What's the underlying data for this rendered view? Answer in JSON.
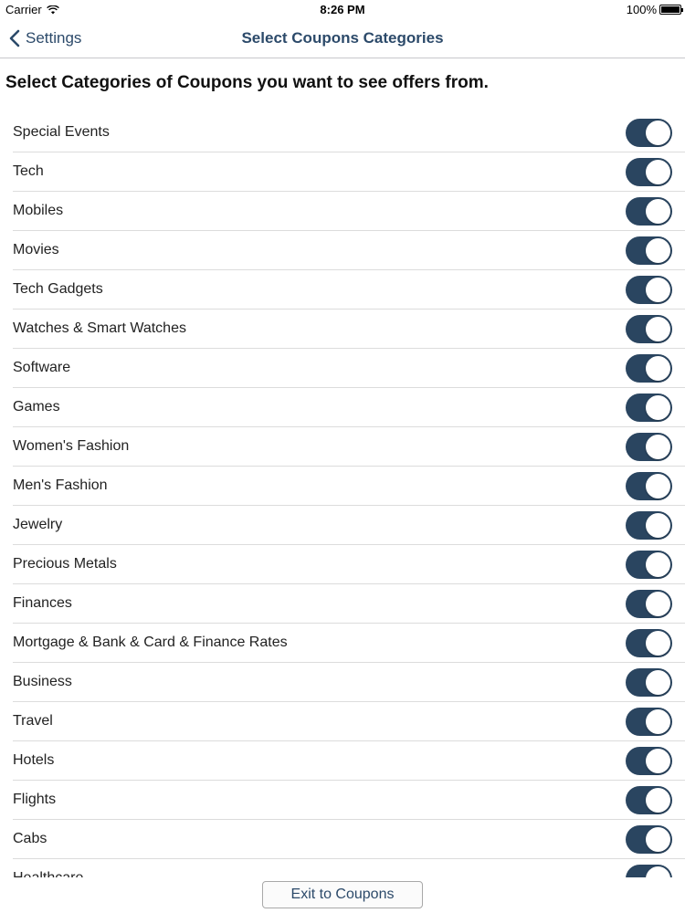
{
  "status_bar": {
    "carrier": "Carrier",
    "time": "8:26 PM",
    "battery": "100%"
  },
  "nav": {
    "back_label": "Settings",
    "title": "Select Coupons Categories"
  },
  "heading": "Select Categories of Coupons you want to see offers from.",
  "categories": [
    {
      "label": "Special Events",
      "on": true
    },
    {
      "label": "Tech",
      "on": true
    },
    {
      "label": "Mobiles",
      "on": true
    },
    {
      "label": "Movies",
      "on": true
    },
    {
      "label": "Tech Gadgets",
      "on": true
    },
    {
      "label": "Watches & Smart Watches",
      "on": true
    },
    {
      "label": "Software",
      "on": true
    },
    {
      "label": "Games",
      "on": true
    },
    {
      "label": "Women's Fashion",
      "on": true
    },
    {
      "label": "Men's Fashion",
      "on": true
    },
    {
      "label": "Jewelry",
      "on": true
    },
    {
      "label": "Precious Metals",
      "on": true
    },
    {
      "label": "Finances",
      "on": true
    },
    {
      "label": "Mortgage & Bank & Card & Finance Rates",
      "on": true
    },
    {
      "label": "Business",
      "on": true
    },
    {
      "label": "Travel",
      "on": true
    },
    {
      "label": "Hotels",
      "on": true
    },
    {
      "label": "Flights",
      "on": true
    },
    {
      "label": "Cabs",
      "on": true
    },
    {
      "label": "Healthcare",
      "on": true
    }
  ],
  "exit_button_label": "Exit to Coupons",
  "colors": {
    "toggle_on": "#2a4560",
    "nav_tint": "#2c4a6a"
  }
}
